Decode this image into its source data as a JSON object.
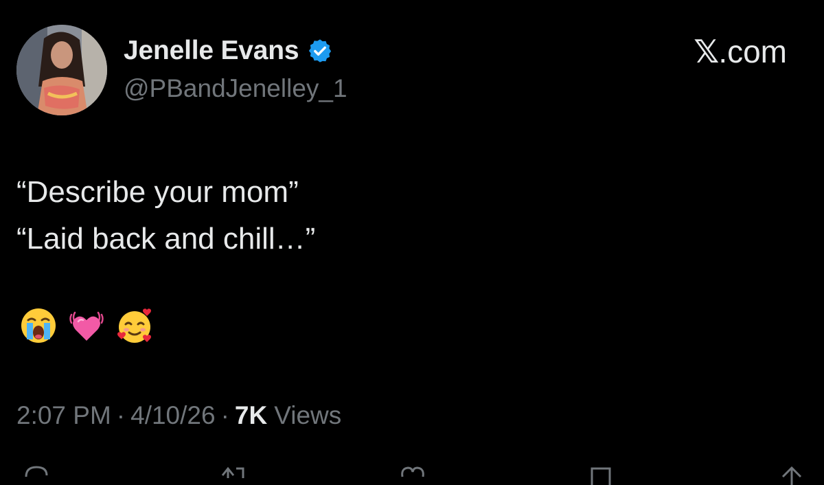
{
  "author": {
    "display_name": "Jenelle Evans",
    "handle": "@PBandJenelley_1",
    "verified": true,
    "verified_color": "#1d9bf0"
  },
  "brand": {
    "label": ".com",
    "logo": "x-logo-icon"
  },
  "tweet": {
    "lines": [
      "“Describe your mom”",
      "“Laid back and chill…”"
    ],
    "emojis": [
      "loudly-crying-face",
      "beating-heart",
      "smiling-face-with-hearts"
    ]
  },
  "meta": {
    "time": "2:07 PM",
    "date": "4/10/26",
    "separator": "·",
    "views_count": "7K",
    "views_label": "Views"
  },
  "actions": [
    "reply-icon",
    "retweet-icon",
    "like-icon",
    "bookmark-icon",
    "share-icon"
  ]
}
